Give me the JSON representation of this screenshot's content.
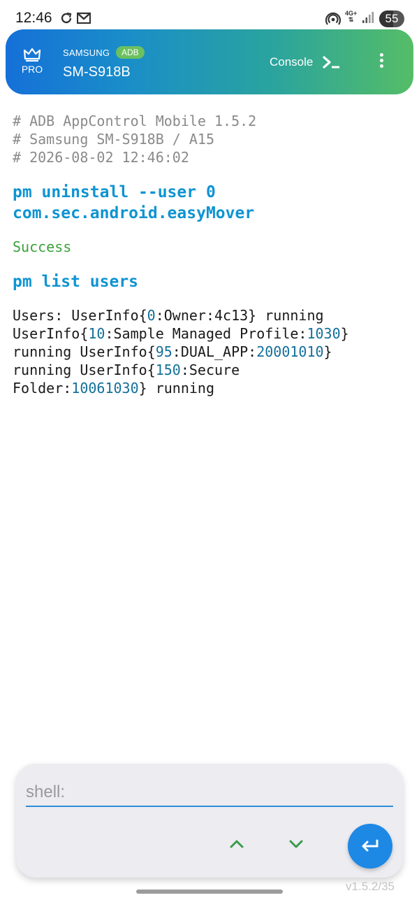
{
  "status_bar": {
    "time": "12:46",
    "network": "4G+",
    "battery": "55",
    "battery_level": 0.55
  },
  "header": {
    "pro_label": "PRO",
    "brand": "SAMSUNG",
    "adb_badge": "ADB",
    "device": "SM-S918B",
    "console_label": "Console",
    "colors": {
      "gradient_start": "#1570d8",
      "gradient_end": "#55bd67",
      "badge": "#6cc05f"
    },
    "icons": [
      "crown-icon",
      "terminal-icon",
      "more-vertical-icon"
    ]
  },
  "console": {
    "comments": [
      "# ADB AppControl Mobile 1.5.2",
      "# Samsung SM-S918B / A15",
      "# 2026-08-02 12:46:02"
    ],
    "cmd1_line1": "pm uninstall --user 0",
    "cmd1_line2": "com.sec.android.easyMover",
    "result1": "Success",
    "cmd2": "pm list users",
    "users_output": [
      [
        "Users: UserInfo{",
        "0",
        ":Owner:4c13} running"
      ],
      [
        "UserInfo{",
        "10",
        ":Sample Managed Profile:",
        "1030",
        "}"
      ],
      [
        "running UserInfo{",
        "95",
        ":DUAL_APP:",
        "20001010",
        "}"
      ],
      [
        "running UserInfo{",
        "150",
        ":Secure"
      ],
      [
        "Folder:",
        "10061030",
        "} running"
      ]
    ],
    "colors": {
      "command": "#0f94d2",
      "success": "#3aa13a",
      "comment": "#8a8a8a",
      "number": "#136f9a"
    }
  },
  "shell": {
    "placeholder": "shell:",
    "value": "",
    "icons": [
      "chevron-up-icon",
      "chevron-down-icon",
      "enter-icon"
    ]
  },
  "footer": {
    "version": "v1.5.2/35"
  }
}
